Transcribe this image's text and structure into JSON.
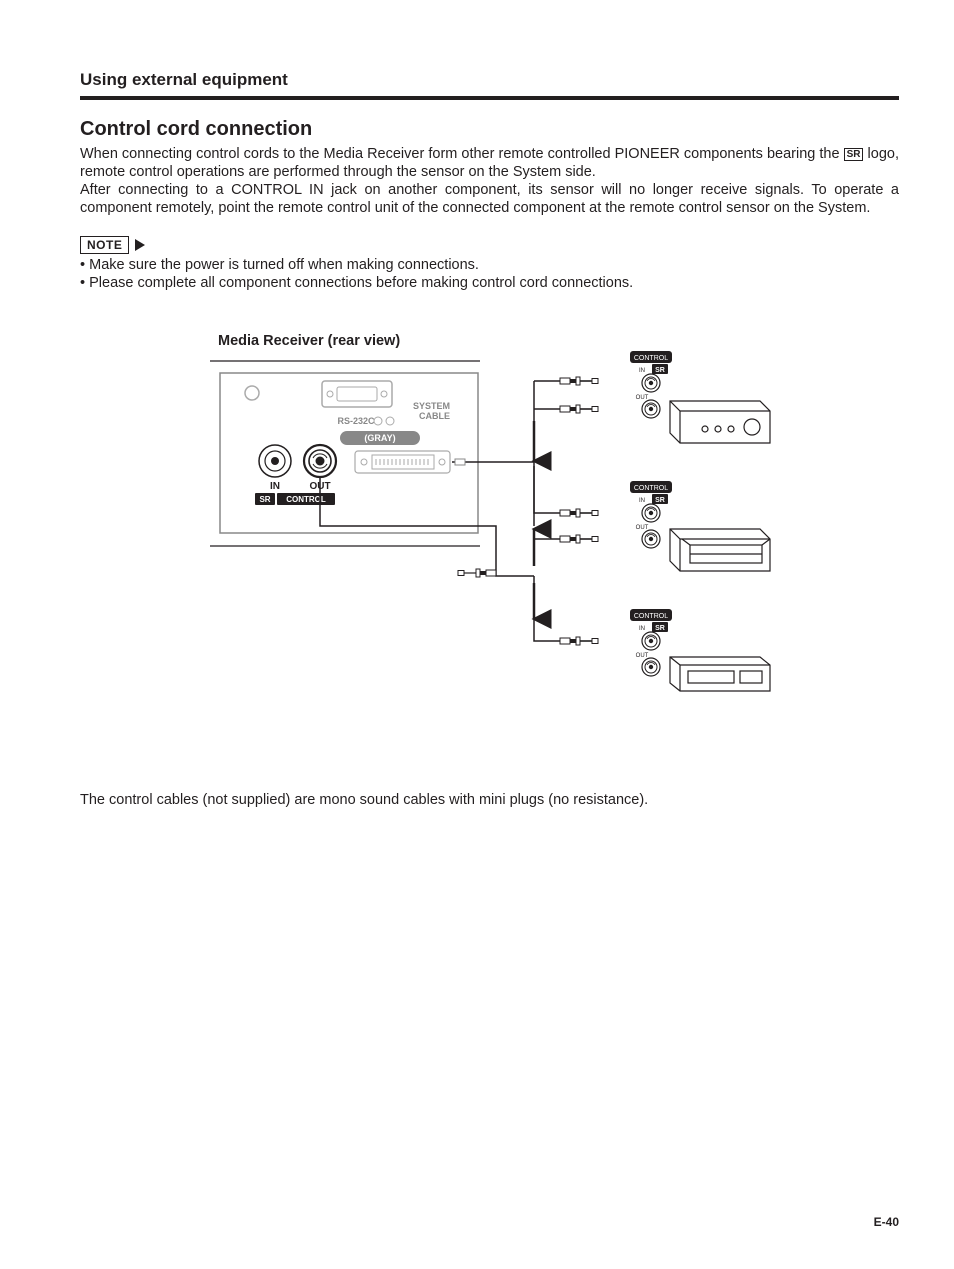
{
  "header": {
    "section": "Using external equipment"
  },
  "title": "Control cord connection",
  "para1a": "When connecting control cords to the Media Receiver form other remote controlled PIONEER components bearing the ",
  "sr_inline": "SR",
  "para1b": " logo, remote control operations are performed through the sensor on the System side.",
  "para2": "After connecting to a CONTROL IN jack on another component, its sensor will no longer receive signals. To operate a component remotely, point the remote control unit of the connected component at the remote control sensor on the System.",
  "note_label": "NOTE",
  "notes": [
    "Make sure the power is turned off when making connections.",
    "Please complete all component connections before making control cord connections."
  ],
  "diagram": {
    "title": "Media Receiver (rear view)",
    "labels": {
      "system_cable": "SYSTEM CABLE",
      "rs232c": "RS-232C",
      "gray": "(GRAY)",
      "in": "IN",
      "out": "OUT",
      "sr": "SR",
      "control": "CONTROL"
    }
  },
  "footnote": "The control cables (not supplied) are mono sound cables with mini plugs (no resistance).",
  "page_num": "E-40"
}
